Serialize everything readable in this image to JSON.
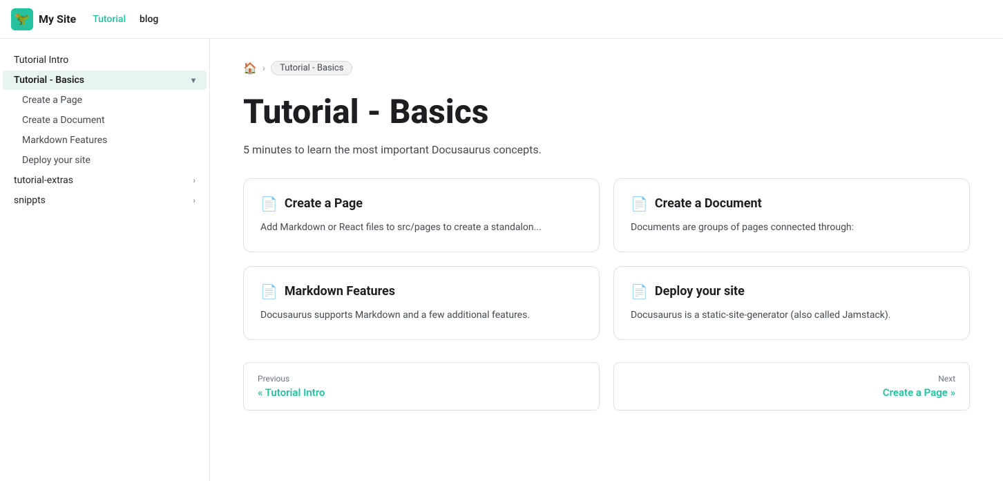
{
  "navbar": {
    "brand_logo": "🦖",
    "brand_name": "My Site",
    "links": [
      {
        "label": "Tutorial",
        "active": true
      },
      {
        "label": "blog",
        "active": false
      }
    ]
  },
  "sidebar": {
    "items": [
      {
        "id": "tutorial-intro",
        "label": "Tutorial Intro",
        "indent": false,
        "active": false,
        "has_chevron": false
      },
      {
        "id": "tutorial-basics",
        "label": "Tutorial - Basics",
        "indent": false,
        "active": true,
        "has_chevron": true
      },
      {
        "id": "create-a-page",
        "label": "Create a Page",
        "indent": true,
        "active": false,
        "has_chevron": false
      },
      {
        "id": "create-a-document",
        "label": "Create a Document",
        "indent": true,
        "active": false,
        "has_chevron": false
      },
      {
        "id": "markdown-features",
        "label": "Markdown Features",
        "indent": true,
        "active": false,
        "has_chevron": false
      },
      {
        "id": "deploy-your-site",
        "label": "Deploy your site",
        "indent": true,
        "active": false,
        "has_chevron": false
      },
      {
        "id": "tutorial-extras",
        "label": "tutorial-extras",
        "indent": false,
        "active": false,
        "has_chevron": true
      },
      {
        "id": "snippts",
        "label": "snippts",
        "indent": false,
        "active": false,
        "has_chevron": true
      }
    ]
  },
  "breadcrumb": {
    "home_icon": "🏠",
    "current": "Tutorial - Basics"
  },
  "page": {
    "title": "Tutorial - Basics",
    "subtitle": "5 minutes to learn the most important Docusaurus concepts."
  },
  "cards": [
    {
      "id": "create-a-page",
      "icon": "📄",
      "title": "Create a Page",
      "desc": "Add Markdown or React files to src/pages to create a standalon..."
    },
    {
      "id": "create-a-document",
      "icon": "📄",
      "title": "Create a Document",
      "desc": "Documents are groups of pages connected through:"
    },
    {
      "id": "markdown-features",
      "icon": "📄",
      "title": "Markdown Features",
      "desc": "Docusaurus supports Markdown and a few additional features."
    },
    {
      "id": "deploy-your-site",
      "icon": "📄",
      "title": "Deploy your site",
      "desc": "Docusaurus is a static-site-generator (also called Jamstack)."
    }
  ],
  "pagination": {
    "prev_label": "Previous",
    "prev_link": "« Tutorial Intro",
    "next_label": "Next",
    "next_link": "Create a Page »"
  }
}
